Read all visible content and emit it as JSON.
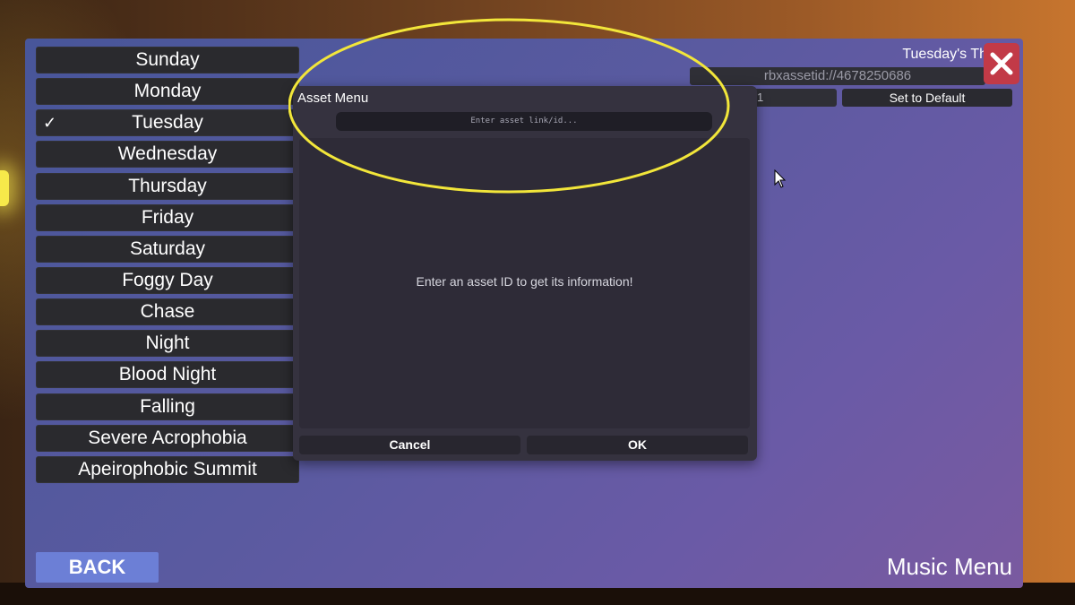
{
  "days": [
    {
      "label": "Sunday",
      "selected": false
    },
    {
      "label": "Monday",
      "selected": false
    },
    {
      "label": "Tuesday",
      "selected": true
    },
    {
      "label": "Wednesday",
      "selected": false
    },
    {
      "label": "Thursday",
      "selected": false
    },
    {
      "label": "Friday",
      "selected": false
    },
    {
      "label": "Saturday",
      "selected": false
    },
    {
      "label": "Foggy Day",
      "selected": false
    },
    {
      "label": "Chase",
      "selected": false
    },
    {
      "label": "Night",
      "selected": false
    },
    {
      "label": "Blood Night",
      "selected": false
    },
    {
      "label": "Falling",
      "selected": false
    },
    {
      "label": "Severe Acrophobia",
      "selected": false
    },
    {
      "label": "Apeirophobic Summit",
      "selected": false
    }
  ],
  "check_glyph": "✓",
  "theme": {
    "title": "Tuesday's Th",
    "asset_id": "rbxassetid://4678250686",
    "volume": "1",
    "default_label": "Set to Default"
  },
  "close_icon": "x-icon",
  "back_label": "BACK",
  "menu_label": "Music Menu",
  "dialog": {
    "title": "Asset Menu",
    "input_placeholder": "Enter asset link/id...",
    "message": "Enter an asset ID to get its information!",
    "cancel_label": "Cancel",
    "ok_label": "OK"
  },
  "colors": {
    "close_red": "#c23a47",
    "back_blue": "#6c7fd6",
    "highlight_yellow": "#f2e63a"
  }
}
